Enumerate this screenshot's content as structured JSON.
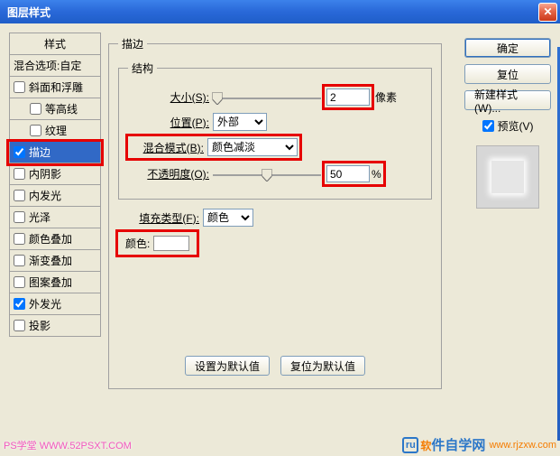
{
  "title": "图层样式",
  "styles_header": "样式",
  "blend_options": "混合选项:自定",
  "styles": [
    {
      "label": "斜面和浮雕",
      "checked": false,
      "indent": false
    },
    {
      "label": "等高线",
      "checked": false,
      "indent": true
    },
    {
      "label": "纹理",
      "checked": false,
      "indent": true
    },
    {
      "label": "描边",
      "checked": true,
      "indent": false,
      "selected": true
    },
    {
      "label": "内阴影",
      "checked": false,
      "indent": false
    },
    {
      "label": "内发光",
      "checked": false,
      "indent": false
    },
    {
      "label": "光泽",
      "checked": false,
      "indent": false
    },
    {
      "label": "颜色叠加",
      "checked": false,
      "indent": false
    },
    {
      "label": "渐变叠加",
      "checked": false,
      "indent": false
    },
    {
      "label": "图案叠加",
      "checked": false,
      "indent": false
    },
    {
      "label": "外发光",
      "checked": true,
      "indent": false
    },
    {
      "label": "投影",
      "checked": false,
      "indent": false
    }
  ],
  "stroke": {
    "fieldset_label": "描边",
    "structure_label": "结构",
    "size_label": "大小(S):",
    "size_value": "2",
    "size_unit": "像素",
    "position_label": "位置(P):",
    "position_value": "外部",
    "blend_label": "混合模式(B):",
    "blend_value": "颜色减淡",
    "opacity_label": "不透明度(O):",
    "opacity_value": "50",
    "opacity_unit": "%",
    "filltype_label": "填充类型(F):",
    "filltype_value": "颜色",
    "color_label": "颜色:",
    "set_default": "设置为默认值",
    "reset_default": "复位为默认值"
  },
  "buttons": {
    "ok": "确定",
    "cancel": "复位",
    "new_style": "新建样式(W)...",
    "preview": "预览(V)"
  },
  "watermark1": "PS学堂  WWW.52PSXT.COM",
  "watermark2_text": "软件自学网",
  "watermark2_url": "www.rjzxw.com"
}
